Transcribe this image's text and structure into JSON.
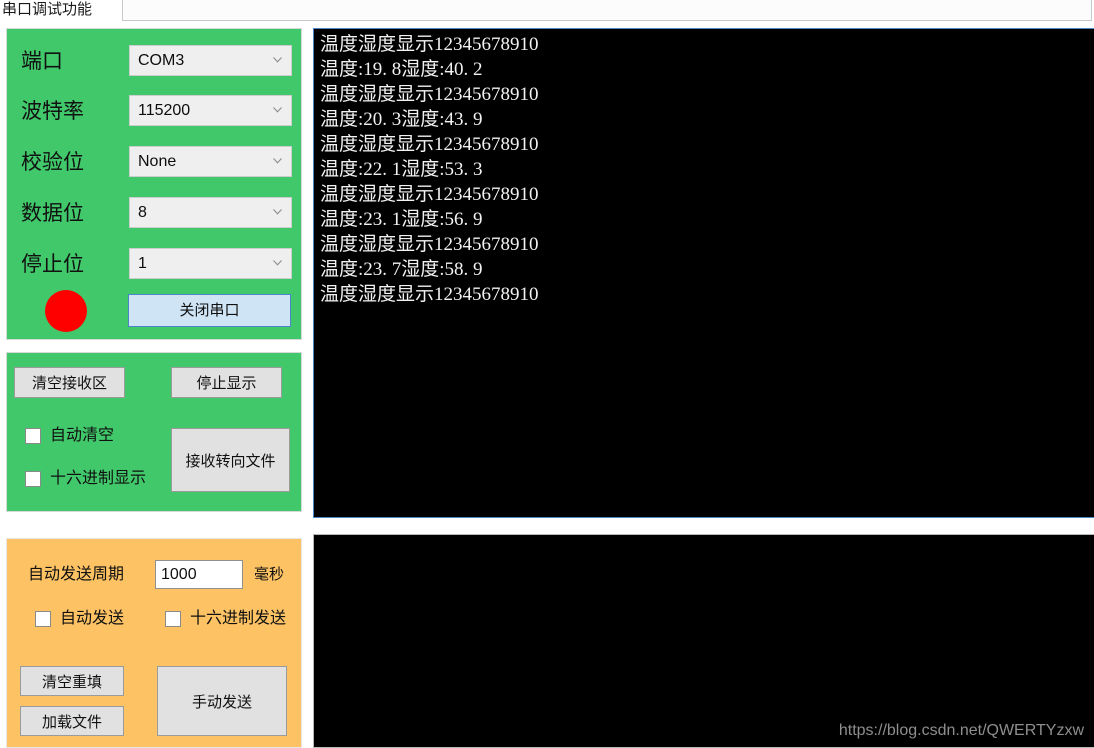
{
  "window": {
    "tab_title": "串口调试功能"
  },
  "colors": {
    "panel_green": "#41c86a",
    "panel_orange": "#fcc263",
    "led_on": "#fe0000",
    "button_gray": "#e1e1e1",
    "close_button_bg": "#cfe4f5",
    "close_button_border": "#4a86c8",
    "terminal_bg": "#000000",
    "terminal_text": "#f2f2f2"
  },
  "config_panel": {
    "rows": [
      {
        "label": "端口",
        "value": "COM3",
        "name": "port"
      },
      {
        "label": "波特率",
        "value": "115200",
        "name": "baudrate"
      },
      {
        "label": "校验位",
        "value": "None",
        "name": "parity"
      },
      {
        "label": "数据位",
        "value": "8",
        "name": "databits"
      },
      {
        "label": "停止位",
        "value": "1",
        "name": "stopbits"
      }
    ],
    "led": {
      "name": "port-status-led",
      "state": "on"
    },
    "close_button": "关闭串口"
  },
  "receive_panel": {
    "clear_button": "清空接收区",
    "stop_button": "停止显示",
    "redirect_button": "接收转向文件",
    "checkbox_auto_clear": {
      "label": "自动清空",
      "checked": false
    },
    "checkbox_hex_display": {
      "label": "十六进制显示",
      "checked": false
    }
  },
  "send_panel": {
    "period_label": "自动发送周期",
    "period_value": "1000",
    "period_unit": "毫秒",
    "checkbox_auto_send": {
      "label": "自动发送",
      "checked": false
    },
    "checkbox_hex_send": {
      "label": "十六进制发送",
      "checked": false
    },
    "clear_refill_button": "清空重填",
    "load_file_button": "加载文件",
    "manual_send_button": "手动发送"
  },
  "receive_terminal": {
    "lines": [
      "温度湿度显示12345678910",
      "温度:19. 8湿度:40. 2",
      "温度湿度显示12345678910",
      "温度:20. 3湿度:43. 9",
      "温度湿度显示12345678910",
      "温度:22. 1湿度:53. 3",
      "温度湿度显示12345678910",
      "温度:23. 1湿度:56. 9",
      "温度湿度显示12345678910",
      "温度:23. 7湿度:58. 9",
      "温度湿度显示12345678910"
    ]
  },
  "send_terminal": {
    "content": ""
  },
  "watermark": {
    "text": "https://blog.csdn.net/QWERTYzxw"
  }
}
